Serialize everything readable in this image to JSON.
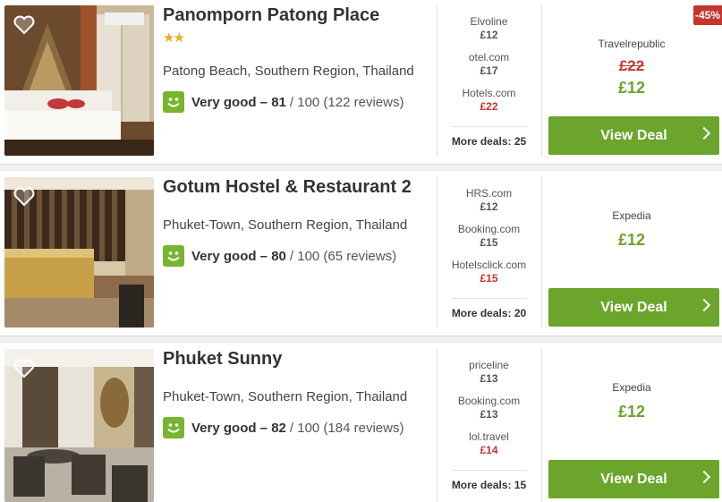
{
  "hotels": [
    {
      "name": "Panomporn Patong Place",
      "stars": "★★",
      "location": "Patong Beach, Southern Region, Thailand",
      "rating_text": "Very good – 81",
      "rating_rest": "/ 100 (122 reviews)",
      "partners": [
        {
          "name": "Elvoline",
          "price": "£12"
        },
        {
          "name": "otel.com",
          "price": "£17"
        },
        {
          "name": "Hotels.com",
          "price": "£22"
        }
      ],
      "more_deals": "More deals: 25",
      "deal_provider": "Travelrepublic",
      "old_price": "£22",
      "deal_price": "£12",
      "discount_badge": "-45%",
      "button_label": "View Deal"
    },
    {
      "name": "Gotum Hostel & Restaurant 2",
      "stars": "",
      "location": "Phuket-Town, Southern Region, Thailand",
      "rating_text": "Very good – 80",
      "rating_rest": "/ 100 (65 reviews)",
      "partners": [
        {
          "name": "HRS.com",
          "price": "£12"
        },
        {
          "name": "Booking.com",
          "price": "£15"
        },
        {
          "name": "Hotelsclick.com",
          "price": "£15"
        }
      ],
      "more_deals": "More deals: 20",
      "deal_provider": "Expedia",
      "deal_price": "£12",
      "button_label": "View Deal"
    },
    {
      "name": "Phuket Sunny",
      "stars": "",
      "location": "Phuket-Town, Southern Region, Thailand",
      "rating_text": "Very good – 82",
      "rating_rest": "/ 100 (184 reviews)",
      "partners": [
        {
          "name": "priceline",
          "price": "£13"
        },
        {
          "name": "Booking.com",
          "price": "£13"
        },
        {
          "name": "lol.travel",
          "price": "£14"
        }
      ],
      "more_deals": "More deals: 15",
      "deal_provider": "Expedia",
      "deal_price": "£12",
      "button_label": "View Deal"
    }
  ],
  "colors": {
    "accent_green": "#6ba52b",
    "price_red": "#c4362e",
    "star_gold": "#e4b028"
  },
  "icons": [
    "heart-icon",
    "smiley-rating-icon",
    "chevron-right-icon"
  ]
}
